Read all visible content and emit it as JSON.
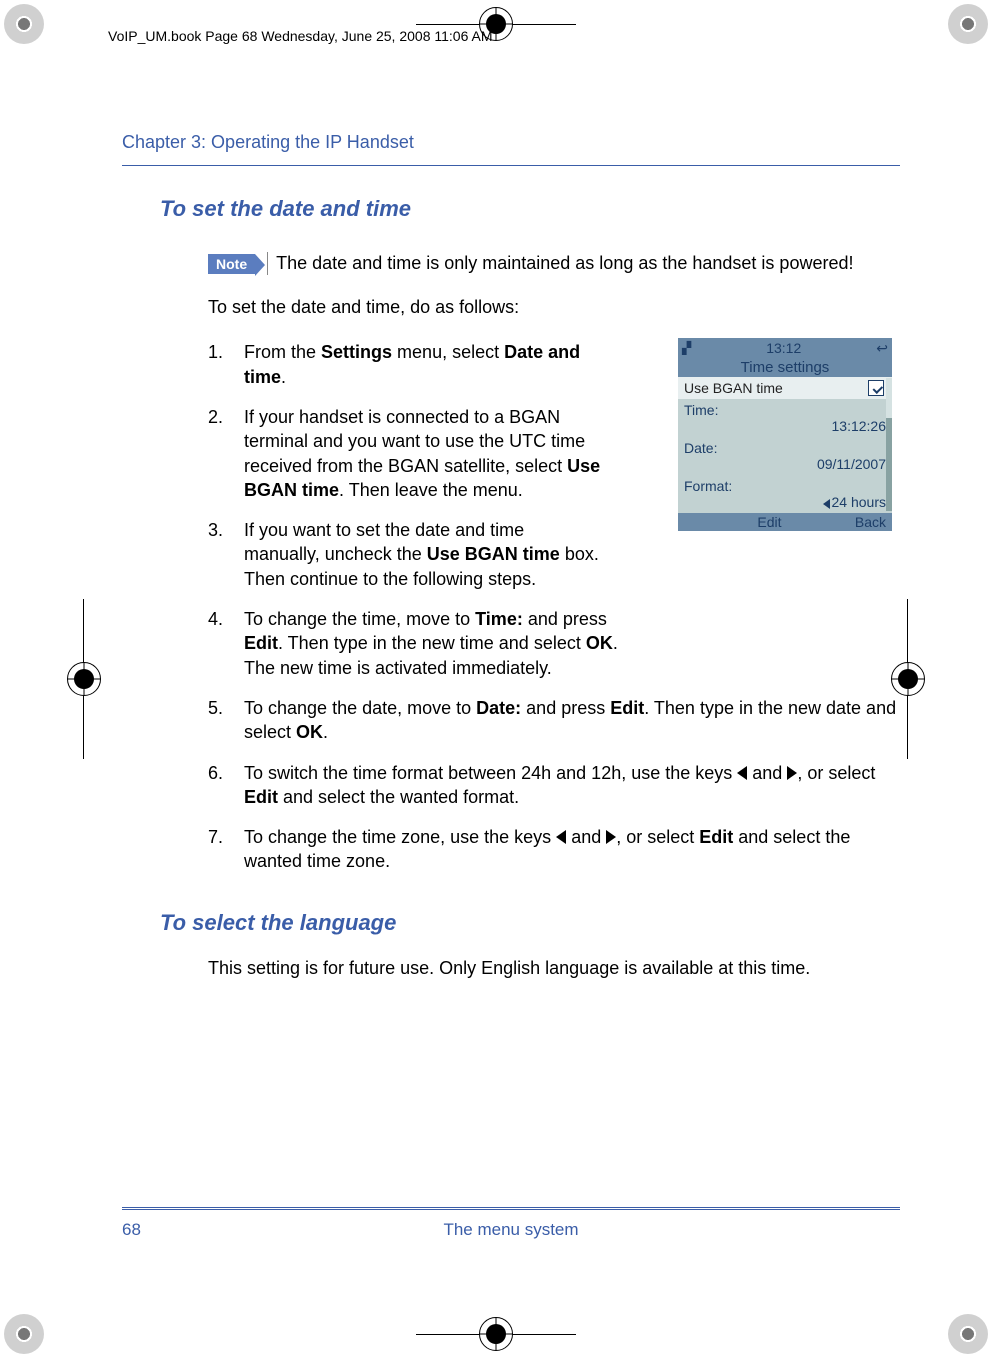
{
  "meta": {
    "filename_line": "VoIP_UM.book  Page 68  Wednesday, June 25, 2008  11:06 AM"
  },
  "chapter": "Chapter 3:  Operating the IP Handset",
  "s1": {
    "title": "To set the date and time",
    "note_label": "Note",
    "note": "The date and time is only maintained as long as the handset is powered!",
    "intro": "To set the date and time, do as follows:",
    "steps": [
      {
        "n": "1.",
        "a": "From the ",
        "b": "Settings",
        "c": " menu, select ",
        "d": "Date and time",
        "e": "."
      },
      {
        "n": "2.",
        "a": "If your handset is connected to a BGAN terminal and you want to use the UTC time received from the BGAN satellite, select ",
        "b": "Use BGAN time",
        "c": ". Then leave the menu."
      },
      {
        "n": "3.",
        "a": "If you want to set the date and time manually, uncheck the ",
        "b": "Use BGAN time",
        "c": " box. Then continue to the following steps."
      },
      {
        "n": "4.",
        "a": "To change the time, move to ",
        "b": "Time:",
        "c": " and press ",
        "d": "Edit",
        "e": ". Then type in the new time and select ",
        "f": "OK",
        "g": ". The new time is activated immediately."
      },
      {
        "n": "5.",
        "a": "To change the date, move to ",
        "b": "Date:",
        "c": " and press ",
        "d": "Edit",
        "e": ". Then type in the new date and select ",
        "f": "OK",
        "g": "."
      },
      {
        "n": "6.",
        "a": "To switch the time format between 24h and 12h, use the keys ",
        "c": " and  ",
        "e": ", or select ",
        "f": "Edit",
        "g": " and select the wanted format."
      },
      {
        "n": "7.",
        "a": "To change the time zone, use the keys ",
        "c": " and  ",
        "e": ", or select ",
        "f": "Edit",
        "g": " and select the wanted time zone."
      }
    ]
  },
  "s2": {
    "title": "To select the language",
    "body": "This setting is for future use. Only English language is available at this time."
  },
  "phone": {
    "clock": "13:12",
    "title": "Time settings",
    "row_use": "Use BGAN time",
    "time_l": "Time:",
    "time_v": "13:12:26",
    "date_l": "Date:",
    "date_v": "09/11/2007",
    "format_l": "Format:",
    "format_v": "24 hours",
    "soft_left": "",
    "soft_mid": "Edit",
    "soft_right": "Back"
  },
  "footer": {
    "page": "68",
    "section": "The menu system"
  }
}
